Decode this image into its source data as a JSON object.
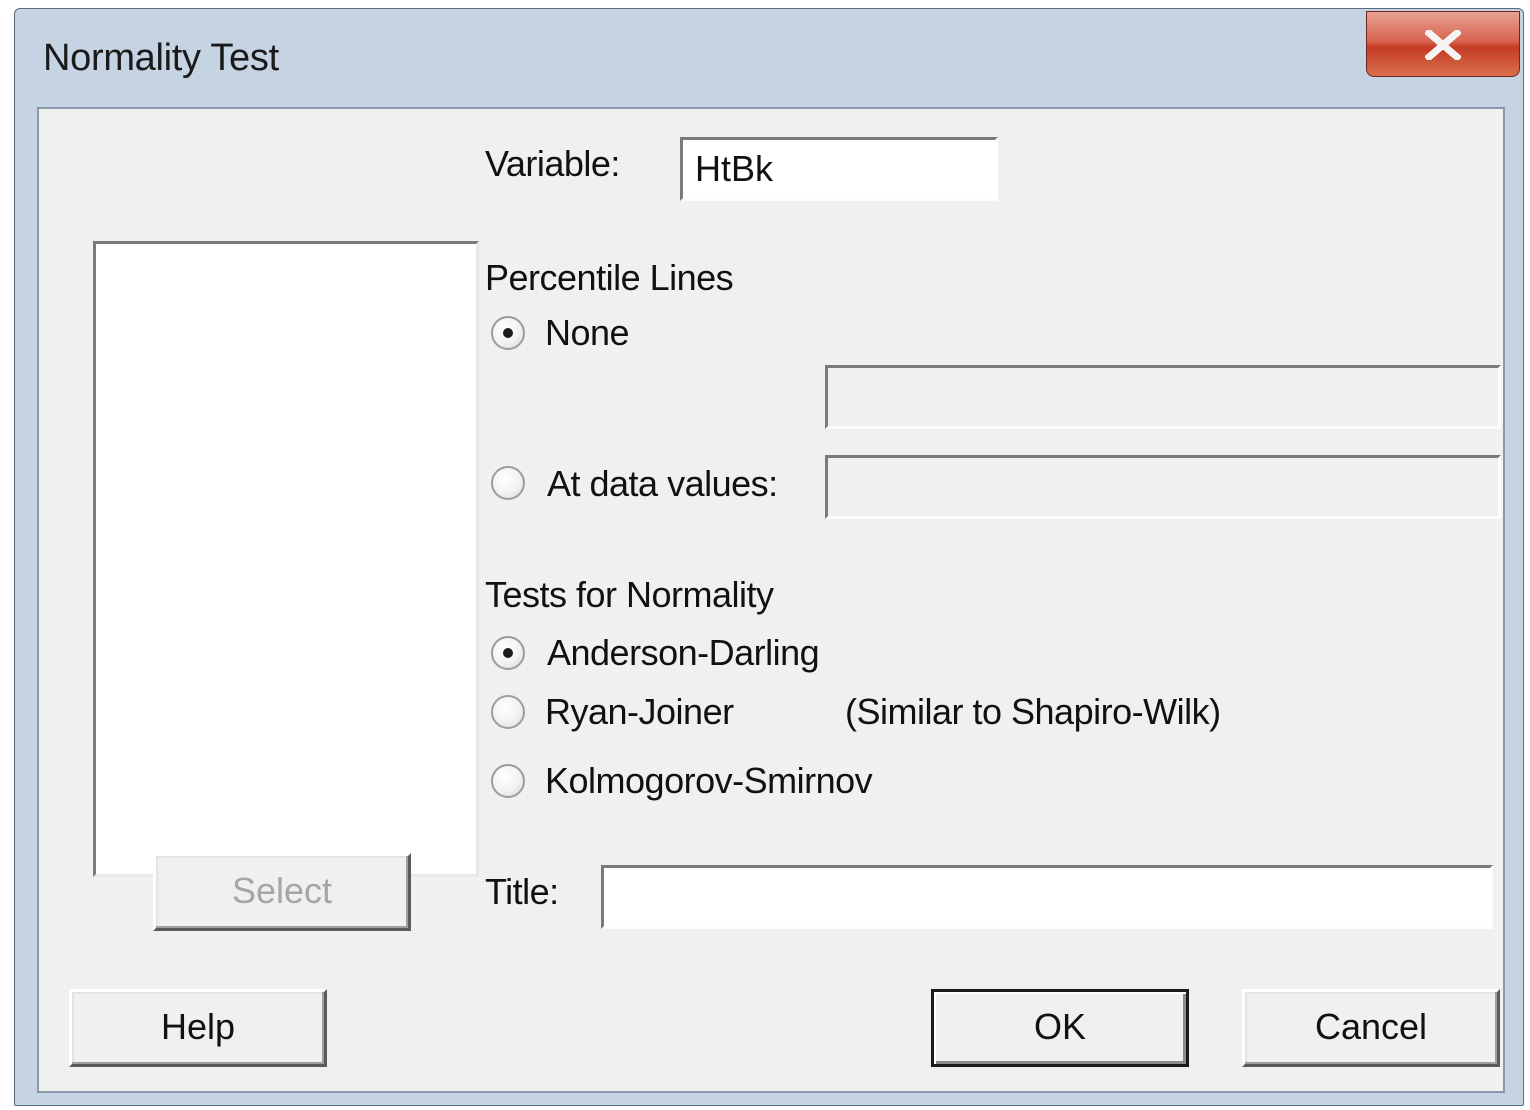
{
  "window": {
    "title": "Normality Test"
  },
  "form": {
    "variable_label": "Variable:",
    "variable_value": "HtBk",
    "percentile_heading": "Percentile Lines",
    "percentile_options": [
      {
        "label": "None",
        "selected": true
      },
      {
        "label": "At data values:",
        "selected": false
      }
    ],
    "percentile_none_value": "",
    "percentile_data_value": "",
    "tests_heading": "Tests for Normality",
    "tests_options": [
      {
        "label": "Anderson-Darling",
        "selected": true
      },
      {
        "label": "Ryan-Joiner",
        "selected": false
      },
      {
        "label": "Kolmogorov-Smirnov",
        "selected": false
      }
    ],
    "ryan_joiner_note": "(Similar to Shapiro-Wilk)",
    "title_label": "Title:",
    "title_value": ""
  },
  "buttons": {
    "select": "Select",
    "help": "Help",
    "ok": "OK",
    "cancel": "Cancel"
  },
  "icons": {
    "close": "close-icon"
  }
}
